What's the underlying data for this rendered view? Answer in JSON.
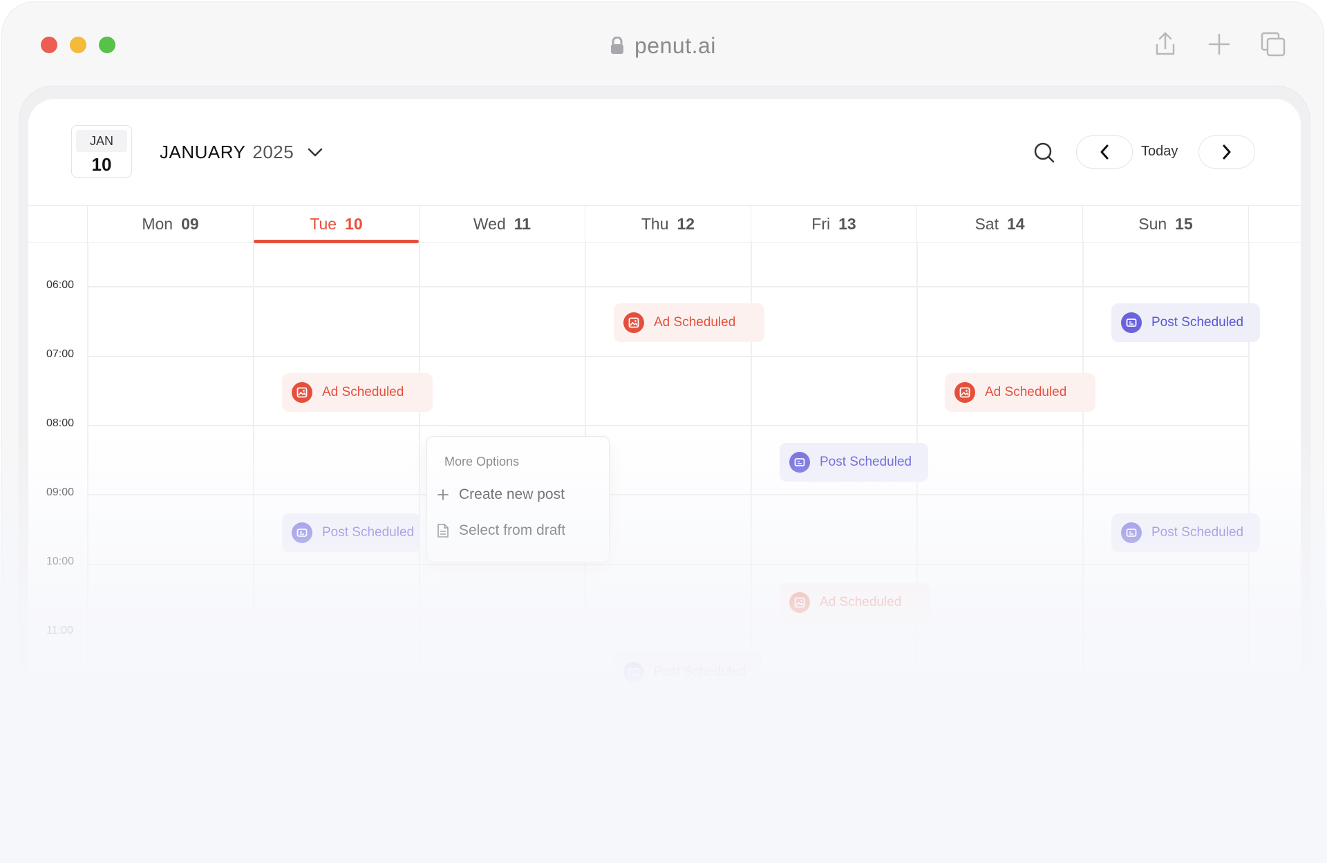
{
  "browser": {
    "url": "penut.ai",
    "icons": [
      "lock-icon",
      "share-icon",
      "plus-icon",
      "tabs-icon"
    ]
  },
  "header": {
    "badge_month": "JAN",
    "badge_day": "10",
    "month": "JANUARY",
    "year": "2025",
    "today_label": "Today"
  },
  "days": [
    {
      "name": "Mon",
      "num": "09"
    },
    {
      "name": "Tue",
      "num": "10"
    },
    {
      "name": "Wed",
      "num": "11"
    },
    {
      "name": "Thu",
      "num": "12"
    },
    {
      "name": "Fri",
      "num": "13"
    },
    {
      "name": "Sat",
      "num": "14"
    },
    {
      "name": "Sun",
      "num": "15"
    }
  ],
  "times": [
    "06:00",
    "07:00",
    "08:00",
    "09:00",
    "10:00",
    "11:00"
  ],
  "events": [
    {
      "label": "Ad Scheduled",
      "kind": "ad"
    },
    {
      "label": "Post Scheduled",
      "kind": "post"
    },
    {
      "label": "Ad Scheduled",
      "kind": "ad"
    },
    {
      "label": "Ad Scheduled",
      "kind": "ad"
    },
    {
      "label": "Post Scheduled",
      "kind": "post"
    },
    {
      "label": "Post Scheduled",
      "kind": "post"
    },
    {
      "label": "Post Scheduled",
      "kind": "post"
    },
    {
      "label": "Ad Scheduled",
      "kind": "ad"
    },
    {
      "label": "Post Scheduled",
      "kind": "post"
    }
  ],
  "menu": {
    "title": "More Options",
    "create": "Create new post",
    "draft": "Select from draft"
  },
  "colors": {
    "today_accent": "#e5503c",
    "ad": "#e5503c",
    "post": "#5b55d6"
  }
}
